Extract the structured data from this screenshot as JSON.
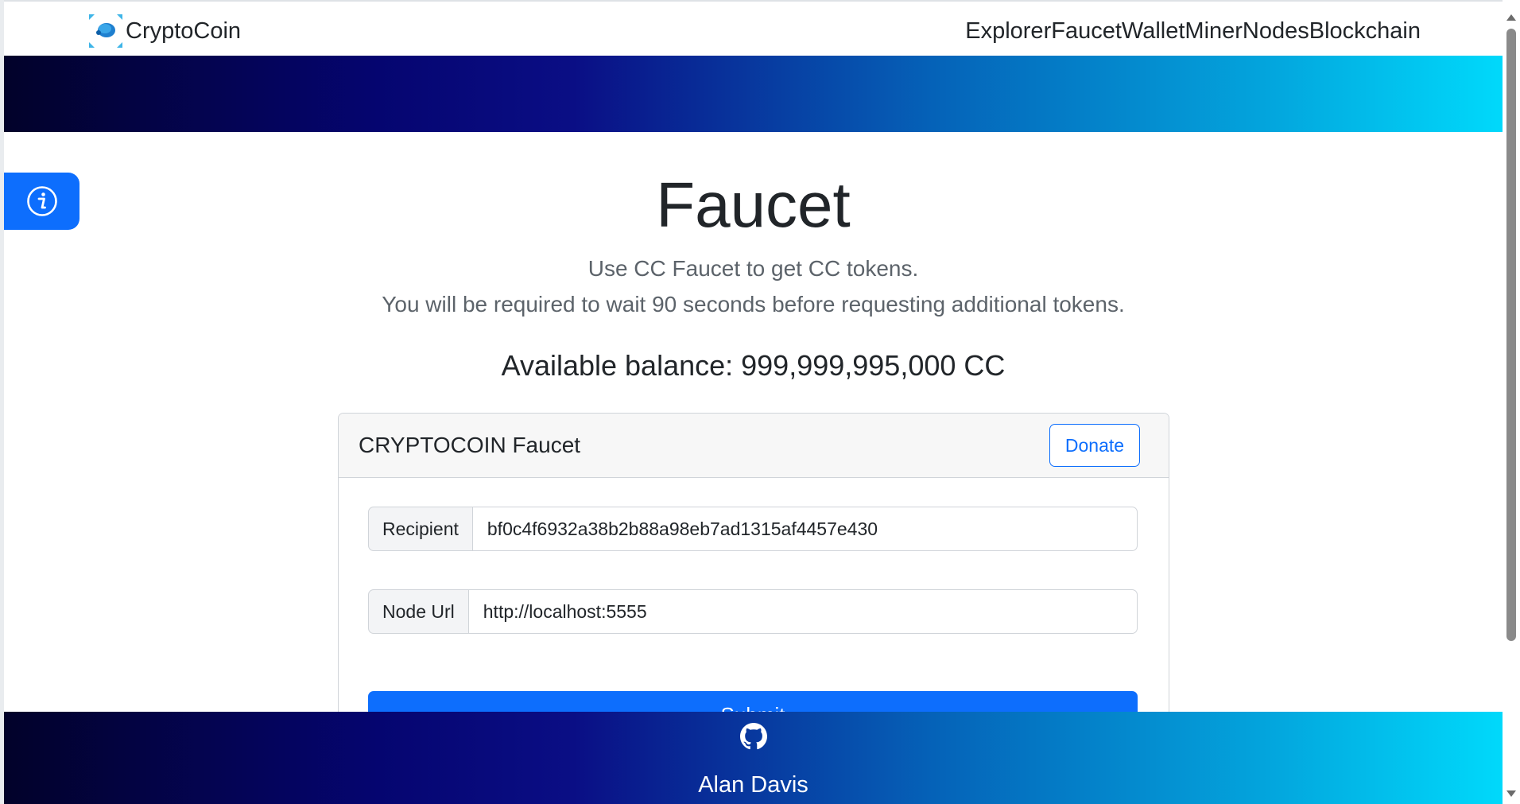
{
  "navbar": {
    "brand": "CryptoCoin",
    "links": [
      "Explorer",
      "Faucet",
      "Wallet",
      "Miner",
      "Nodes",
      "Blockchain"
    ]
  },
  "main": {
    "title": "Faucet",
    "subtitle_1": "Use CC Faucet to get CC tokens.",
    "subtitle_2": "You will be required to wait 90 seconds before requesting additional tokens.",
    "balance": "Available balance: 999,999,995,000 CC"
  },
  "card": {
    "title": "CRYPTOCOIN Faucet",
    "donate_label": "Donate",
    "recipient_label": "Recipient",
    "recipient_value": "bf0c4f6932a38b2b88a98eb7ad1315af4457e430",
    "node_url_label": "Node Url",
    "node_url_value": "http://localhost:5555",
    "submit_label": "Submit"
  },
  "footer": {
    "name": "Alan Davis",
    "icon": "github-icon"
  },
  "colors": {
    "primary": "#0d6efd",
    "gradient_start": "#02022a",
    "gradient_mid": "#0a0e85",
    "gradient_end": "#00d9fb"
  },
  "icons": {
    "info": "info-icon",
    "logo": "cryptocoin-logo-icon"
  }
}
